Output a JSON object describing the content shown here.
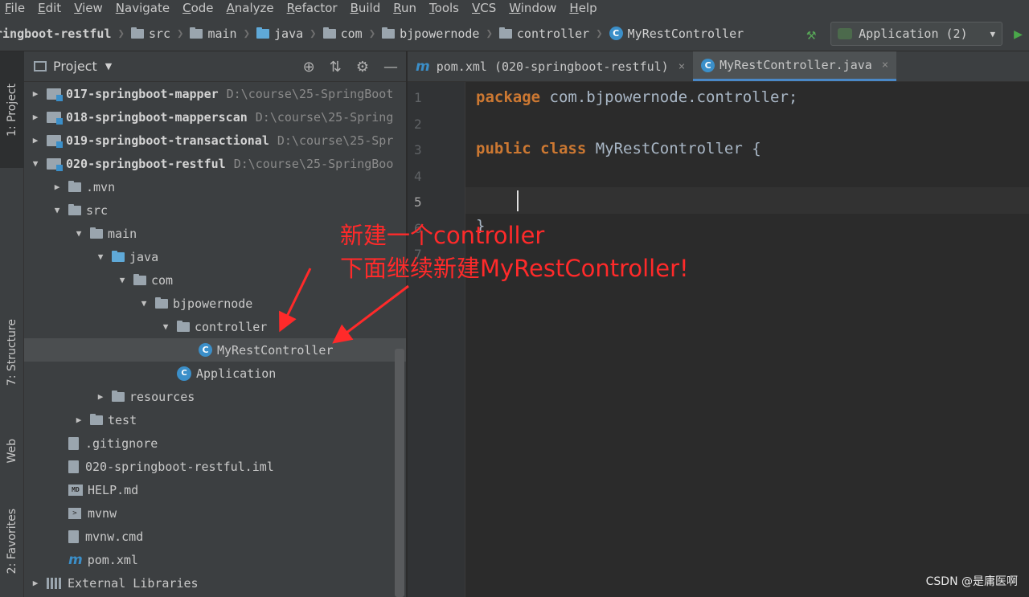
{
  "menu": [
    "File",
    "Edit",
    "View",
    "Navigate",
    "Code",
    "Analyze",
    "Refactor",
    "Build",
    "Run",
    "Tools",
    "VCS",
    "Window",
    "Help"
  ],
  "breadcrumbs": [
    {
      "label": "ringboot-restful",
      "icon": "module"
    },
    {
      "label": "src",
      "icon": "folder"
    },
    {
      "label": "main",
      "icon": "folder"
    },
    {
      "label": "java",
      "icon": "folder-blue"
    },
    {
      "label": "com",
      "icon": "folder"
    },
    {
      "label": "bjpowernode",
      "icon": "folder"
    },
    {
      "label": "controller",
      "icon": "folder"
    },
    {
      "label": "MyRestController",
      "icon": "class"
    }
  ],
  "run_config": {
    "label": "Application (2)"
  },
  "left_tabs": {
    "project": "1: Project",
    "structure": "7: Structure",
    "web": "Web",
    "favorites": "2: Favorites"
  },
  "project_panel": {
    "title": "Project"
  },
  "tree": [
    {
      "label": "017-springboot-mapper",
      "path": "D:\\course\\25-SpringBoot",
      "icon": "module",
      "arrow": "collapsed",
      "indent": 0,
      "bold": true
    },
    {
      "label": "018-springboot-mapperscan",
      "path": "D:\\course\\25-Spring",
      "icon": "module",
      "arrow": "collapsed",
      "indent": 0,
      "bold": true
    },
    {
      "label": "019-springboot-transactional",
      "path": "D:\\course\\25-Spr",
      "icon": "module",
      "arrow": "collapsed",
      "indent": 0,
      "bold": true
    },
    {
      "label": "020-springboot-restful",
      "path": "D:\\course\\25-SpringBoo",
      "icon": "module",
      "arrow": "expanded",
      "indent": 0,
      "bold": true
    },
    {
      "label": ".mvn",
      "path": "",
      "icon": "folder",
      "arrow": "collapsed",
      "indent": 1
    },
    {
      "label": "src",
      "path": "",
      "icon": "folder",
      "arrow": "expanded",
      "indent": 1
    },
    {
      "label": "main",
      "path": "",
      "icon": "folder",
      "arrow": "expanded",
      "indent": 2
    },
    {
      "label": "java",
      "path": "",
      "icon": "folder-blue",
      "arrow": "expanded",
      "indent": 3
    },
    {
      "label": "com",
      "path": "",
      "icon": "folder",
      "arrow": "expanded",
      "indent": 4
    },
    {
      "label": "bjpowernode",
      "path": "",
      "icon": "folder",
      "arrow": "expanded",
      "indent": 5
    },
    {
      "label": "controller",
      "path": "",
      "icon": "folder",
      "arrow": "expanded",
      "indent": 6
    },
    {
      "label": "MyRestController",
      "path": "",
      "icon": "class",
      "arrow": "none",
      "indent": 7,
      "selected": true
    },
    {
      "label": "Application",
      "path": "",
      "icon": "app",
      "arrow": "none",
      "indent": 6
    },
    {
      "label": "resources",
      "path": "",
      "icon": "folder",
      "arrow": "collapsed",
      "indent": 3
    },
    {
      "label": "test",
      "path": "",
      "icon": "folder",
      "arrow": "collapsed",
      "indent": 2
    },
    {
      "label": ".gitignore",
      "path": "",
      "icon": "file",
      "arrow": "none",
      "indent": 1
    },
    {
      "label": "020-springboot-restful.iml",
      "path": "",
      "icon": "file",
      "arrow": "none",
      "indent": 1
    },
    {
      "label": "HELP.md",
      "path": "",
      "icon": "md",
      "arrow": "none",
      "indent": 1
    },
    {
      "label": "mvnw",
      "path": "",
      "icon": "term",
      "arrow": "none",
      "indent": 1
    },
    {
      "label": "mvnw.cmd",
      "path": "",
      "icon": "file",
      "arrow": "none",
      "indent": 1
    },
    {
      "label": "pom.xml",
      "path": "",
      "icon": "maven",
      "arrow": "none",
      "indent": 1
    },
    {
      "label": "External Libraries",
      "path": "",
      "icon": "lib",
      "arrow": "collapsed",
      "indent": 0
    }
  ],
  "editor_tabs": [
    {
      "label": "pom.xml (020-springboot-restful)",
      "icon": "maven",
      "active": false
    },
    {
      "label": "MyRestController.java",
      "icon": "class",
      "active": true
    }
  ],
  "code": {
    "line_numbers": [
      "1",
      "2",
      "3",
      "4",
      "5",
      "6",
      "7"
    ],
    "line1_kw": "package",
    "line1_rest": " com.bjpowernode.controller;",
    "line3_kw1": "public",
    "line3_kw2": "class",
    "line3_rest": " MyRestController {",
    "line6": "}"
  },
  "annotation": {
    "line1": "新建一个controller",
    "line2": "下面继续新建MyRestController!",
    "color": "#ff2a2a"
  },
  "watermark": "CSDN @是庸医啊",
  "colors": {
    "keyword": "#cc7832",
    "accent": "#3b8fc9",
    "selection": "#4b4e50"
  }
}
